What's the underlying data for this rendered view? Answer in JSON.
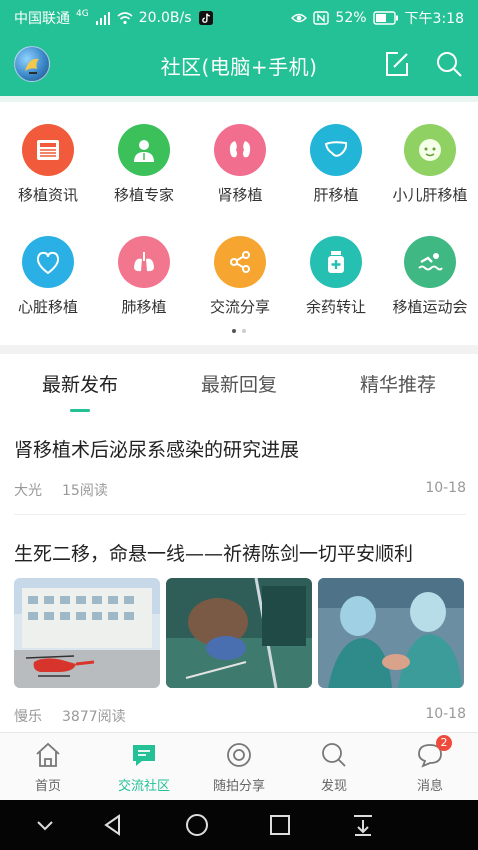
{
  "status_bar": {
    "carrier": "中国联通",
    "network_type": "4G",
    "speed": "20.0B/s",
    "battery": "52%",
    "time": "下午3:18"
  },
  "header": {
    "title": "社区(电脑+手机)",
    "avatar_icon": "avatar-bird-icon",
    "edit_icon": "edit-icon",
    "search_icon": "search-icon"
  },
  "categories": [
    {
      "label": "移植资讯",
      "icon": "news-icon",
      "color": "#f15a3a"
    },
    {
      "label": "移植专家",
      "icon": "doctor-icon",
      "color": "#3cc05a"
    },
    {
      "label": "肾移植",
      "icon": "kidney-icon",
      "color": "#f26e8f"
    },
    {
      "label": "肝移植",
      "icon": "liver-icon",
      "color": "#23b5d8"
    },
    {
      "label": "小儿肝移植",
      "icon": "baby-face-icon",
      "color": "#8fd163"
    },
    {
      "label": "心脏移植",
      "icon": "heart-icon",
      "color": "#2bb0e6"
    },
    {
      "label": "肺移植",
      "icon": "lungs-icon",
      "color": "#f2768d"
    },
    {
      "label": "交流分享",
      "icon": "share-icon",
      "color": "#f7a531"
    },
    {
      "label": "余药转让",
      "icon": "medicine-icon",
      "color": "#26c0b3"
    },
    {
      "label": "移植运动会",
      "icon": "swimming-icon",
      "color": "#3fb884"
    }
  ],
  "pager": {
    "pages": 2,
    "current": 1
  },
  "tabs": [
    {
      "label": "最新发布",
      "active": true
    },
    {
      "label": "最新回复",
      "active": false
    },
    {
      "label": "精华推荐",
      "active": false
    }
  ],
  "posts": [
    {
      "title": "肾移植术后泌尿系感染的研究进展",
      "author": "大光",
      "reads": "15阅读",
      "date": "10-18"
    },
    {
      "title": "生死二移，命悬一线——祈祷陈剑一切平安顺利",
      "author": "慢乐",
      "reads": "3877阅读",
      "date": "10-18",
      "photos": [
        "helicopter-hospital-photo",
        "surgery-patient-photo",
        "surgeons-operating-photo"
      ]
    }
  ],
  "bottom_nav": [
    {
      "label": "首页",
      "icon": "home-icon",
      "active": false
    },
    {
      "label": "交流社区",
      "icon": "chat-icon",
      "active": true
    },
    {
      "label": "随拍分享",
      "icon": "camera-icon",
      "active": false
    },
    {
      "label": "发现",
      "icon": "discover-search-icon",
      "active": false
    },
    {
      "label": "消息",
      "icon": "message-icon",
      "active": false,
      "badge": "2"
    }
  ],
  "colors": {
    "accent": "#25c196",
    "badge": "#f04a3c"
  }
}
